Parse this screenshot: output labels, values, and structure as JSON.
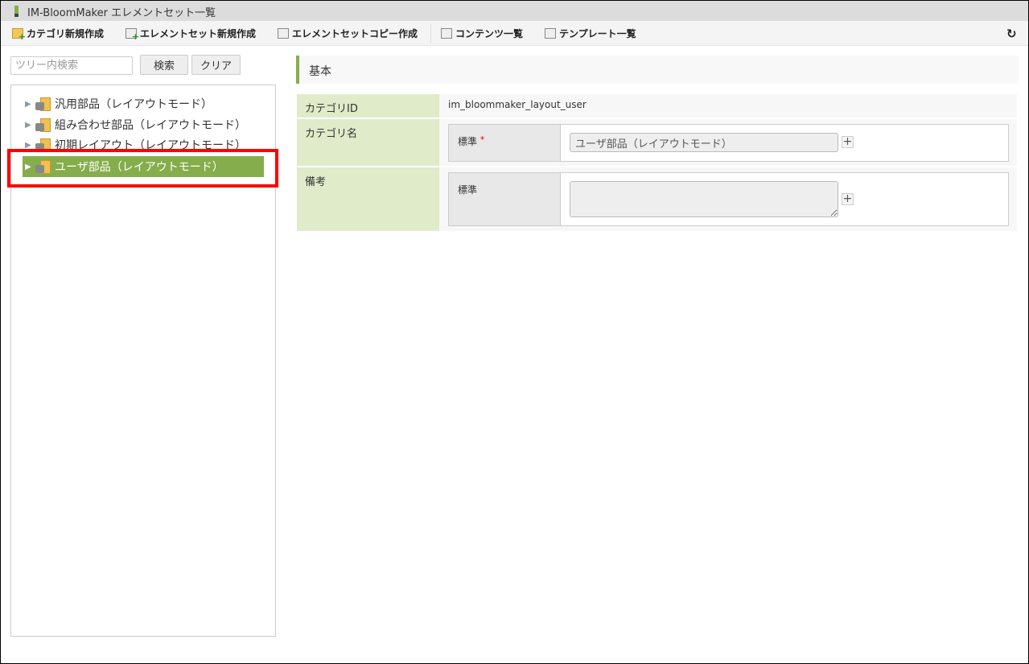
{
  "window": {
    "title": "IM-BloomMaker エレメントセット一覧"
  },
  "toolbar": {
    "new_category": "カテゴリ新規作成",
    "new_element_set": "エレメントセット新規作成",
    "copy_element_set": "エレメントセットコピー作成",
    "contents_list": "コンテンツ一覧",
    "template_list": "テンプレート一覧",
    "refresh_icon": "↻"
  },
  "search": {
    "placeholder": "ツリー内検索",
    "value": "",
    "search_button": "検索",
    "clear_button": "クリア"
  },
  "tree": {
    "items": [
      {
        "label": "汎用部品（レイアウトモード）"
      },
      {
        "label": "組み合わせ部品（レイアウトモード）"
      },
      {
        "label": "初期レイアウト（レイアウトモード）"
      },
      {
        "label": "ユーザ部品（レイアウトモード）",
        "selected": true
      }
    ]
  },
  "detail": {
    "section_title": "基本",
    "category_id_label": "カテゴリID",
    "category_id_value": "im_bloommaker_layout_user",
    "category_name_label": "カテゴリ名",
    "standard_label": "標準",
    "required_mark": "*",
    "category_name_value": "ユーザ部品（レイアウトモード）",
    "remarks_label": "備考",
    "remarks_standard_label": "標準",
    "remarks_value": "",
    "add": "+"
  },
  "colors": {
    "accent": "#86ad4b",
    "label_bg": "#dfebc9",
    "highlight": "#ff0000"
  }
}
